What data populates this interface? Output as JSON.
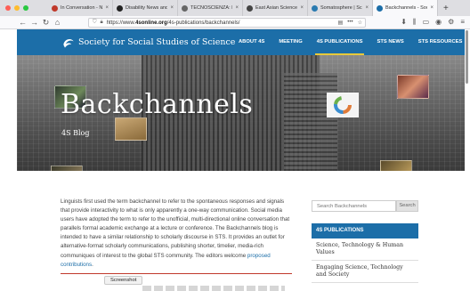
{
  "browser": {
    "tabs": [
      {
        "label": "In Conversation - Natur",
        "active": false,
        "icon_color": "#c0392b"
      },
      {
        "label": "Disability News and Ar",
        "active": false,
        "icon_color": "#222222"
      },
      {
        "label": "TECNOSCIENZA: Italian",
        "active": false,
        "icon_color": "#666666"
      },
      {
        "label": "East Asian Science, Te",
        "active": false,
        "icon_color": "#444444"
      },
      {
        "label": "Somatosphere | Scienc",
        "active": false,
        "icon_color": "#2a7ab0"
      },
      {
        "label": "Backchannels - Societ",
        "active": true,
        "icon_color": "#1c6ea8"
      }
    ],
    "close_glyph": "×",
    "new_tab_glyph": "+",
    "url_prefix": "https://www.",
    "url_host": "4sonline.org",
    "url_path": "/4s-publications/backchannels/",
    "nav_icons": {
      "back": "←",
      "forward": "→",
      "reload": "↻",
      "home": "⌂"
    },
    "url_icons": {
      "more": "•••",
      "bookmark": "☆",
      "reader": "▤"
    },
    "tool_icons": [
      "⬇",
      "⫼",
      "▭",
      "◉",
      "⚙",
      "≡"
    ]
  },
  "site": {
    "title": "Society for Social Studies of Science",
    "nav": [
      {
        "label": "ABOUT 4S",
        "active": false
      },
      {
        "label": "MEETING",
        "active": false
      },
      {
        "label": "4S PUBLICATIONS",
        "active": true
      },
      {
        "label": "STS NEWS",
        "active": false
      },
      {
        "label": "STS RESOURCES",
        "active": false
      }
    ]
  },
  "hero": {
    "title": "Backchannels",
    "subtitle": "4S Blog"
  },
  "article": {
    "body": "Linguists first used the term backchannel to refer to the spontaneous responses and signals that provide interactivity to what is only apparently a one-way communication. Social media users have adopted the term to refer to the unofficial, multi-directional online conversation that parallels formal academic exchange at a lecture or conference. The Backchannels blog is intended to have a similar relationship to scholarly discourse in STS. It provides an outlet for alternative-format scholarly communications, publishing shorter, timelier, media-rich communiques of interest to the global STS community. The editors welcome ",
    "link": "proposed contributions",
    "end": "."
  },
  "tooltip": "Screenshot",
  "sidebar": {
    "search_placeholder": "Search Backchannels",
    "search_button": "Search",
    "pubs_heading": "4S PUBLICATIONS",
    "pubs": [
      "Science, Technology & Human Values",
      "Engaging Science, Technology and Society"
    ]
  },
  "colors": {
    "brand_blue": "#1c6ea8",
    "nav_active_underline": "#e8ca3a",
    "traffic_red": "#fe5f57",
    "traffic_yellow": "#febc2e",
    "traffic_green": "#28c840"
  }
}
